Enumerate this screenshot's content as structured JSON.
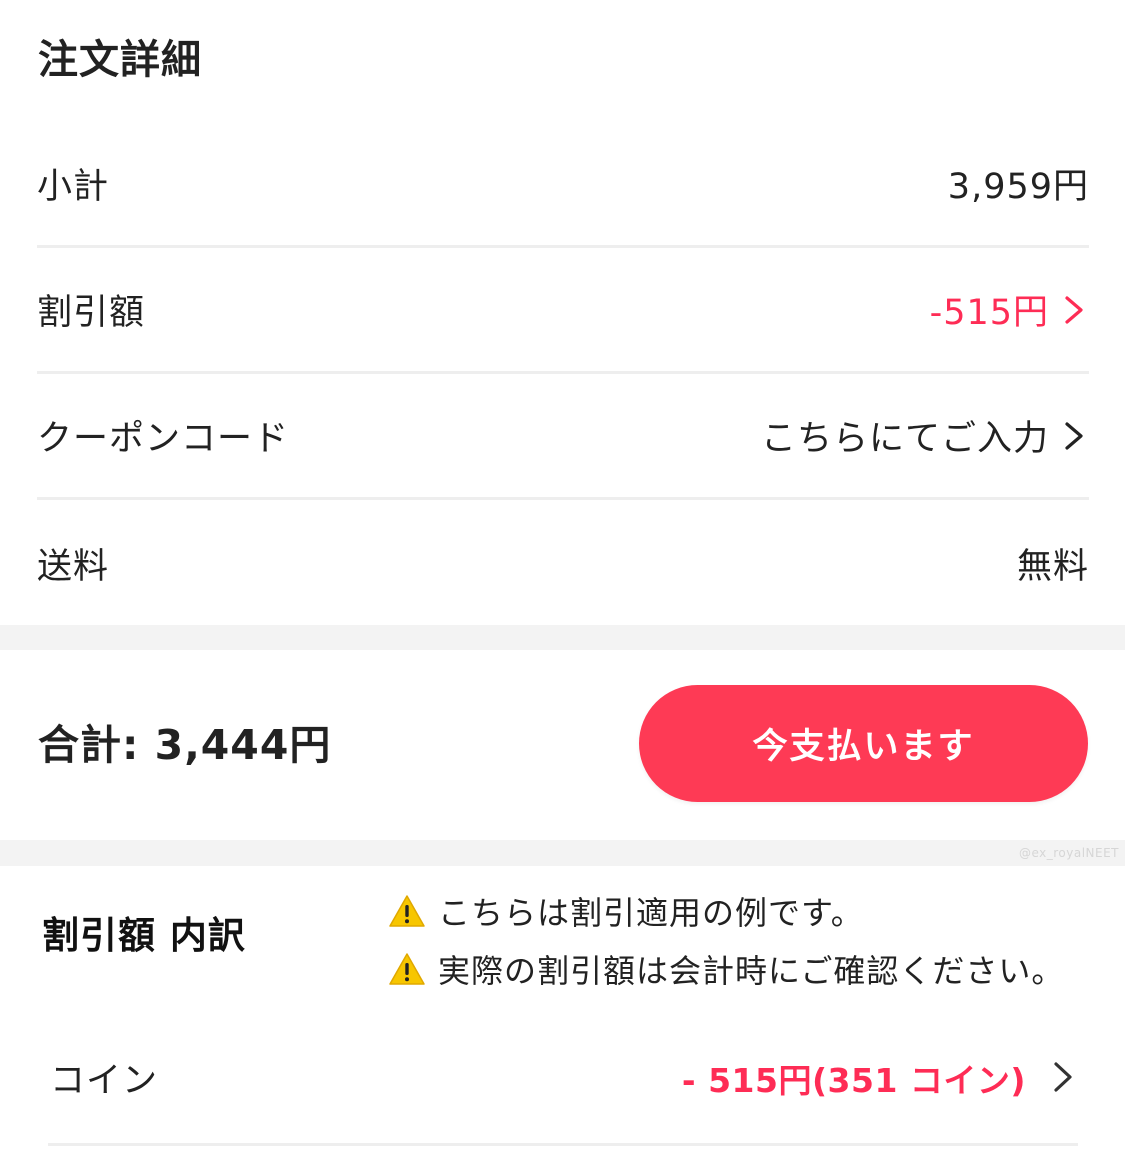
{
  "order_details": {
    "title": "注文詳細",
    "rows": [
      {
        "label": "小計",
        "value": "3,959円",
        "value_color": "#222222",
        "has_chevron": false
      },
      {
        "label": "割引額",
        "value": "-515円",
        "value_color": "#fe2c55",
        "has_chevron": true
      },
      {
        "label": "クーポンコード",
        "value": "こちらにてご入力",
        "value_color": "#222222",
        "has_chevron": true
      },
      {
        "label": "送料",
        "value": "無料",
        "value_color": "#222222",
        "has_chevron": false
      }
    ]
  },
  "checkout": {
    "total_label": "合計: 3,444円",
    "pay_button_label": "今支払います",
    "pay_button_color": "#fe3a55"
  },
  "watermark": "@ex_royalNEET",
  "discount_breakdown": {
    "title": "割引額 内訳",
    "notices": [
      {
        "icon": "warning-icon",
        "text": "こちらは割引適用の例です。"
      },
      {
        "icon": "warning-icon",
        "text": "実際の割引額は会計時にご確認ください。"
      }
    ],
    "coin_row": {
      "label": "コイン",
      "value": "- 515円(351 コイン)",
      "value_color": "#fe2c55"
    }
  }
}
